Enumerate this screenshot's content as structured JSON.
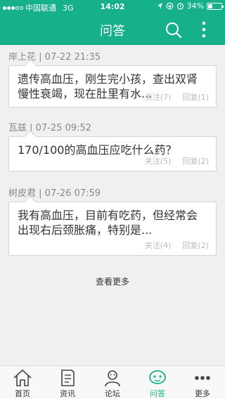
{
  "status_bar": {
    "carrier": "中国联通",
    "network": "3G",
    "time": "14:02",
    "battery": "34%",
    "battery_level": 0.34
  },
  "header": {
    "title": "问答",
    "accent_color": "#16b08a"
  },
  "posts": [
    {
      "user": "岸上花",
      "date": "07-22 21:35",
      "content": "遗传高血压，刚生完小孩，查出双肾慢性衰竭，现在肚里有水...",
      "follows": "关注(7)",
      "replies": "回复(1)"
    },
    {
      "user": "瓦兹",
      "date": "07-25 09:52",
      "content": "170/100的高血压应吃什么药？",
      "follows": "关注(5)",
      "replies": "回复(2)"
    },
    {
      "user": "树皮君",
      "date": "07-26 07:59",
      "content": "我有高血压，目前有吃药，但经常会出现右后颈胀痛，特别是...",
      "follows": "关注(4)",
      "replies": "回复(2)"
    }
  ],
  "load_more": "查看更多",
  "tabs": [
    {
      "label": "首页",
      "icon": "home-icon"
    },
    {
      "label": "资讯",
      "icon": "news-icon"
    },
    {
      "label": "论坛",
      "icon": "forum-icon"
    },
    {
      "label": "问答",
      "icon": "qa-icon",
      "active": true
    },
    {
      "label": "更多",
      "icon": "more-icon"
    }
  ]
}
